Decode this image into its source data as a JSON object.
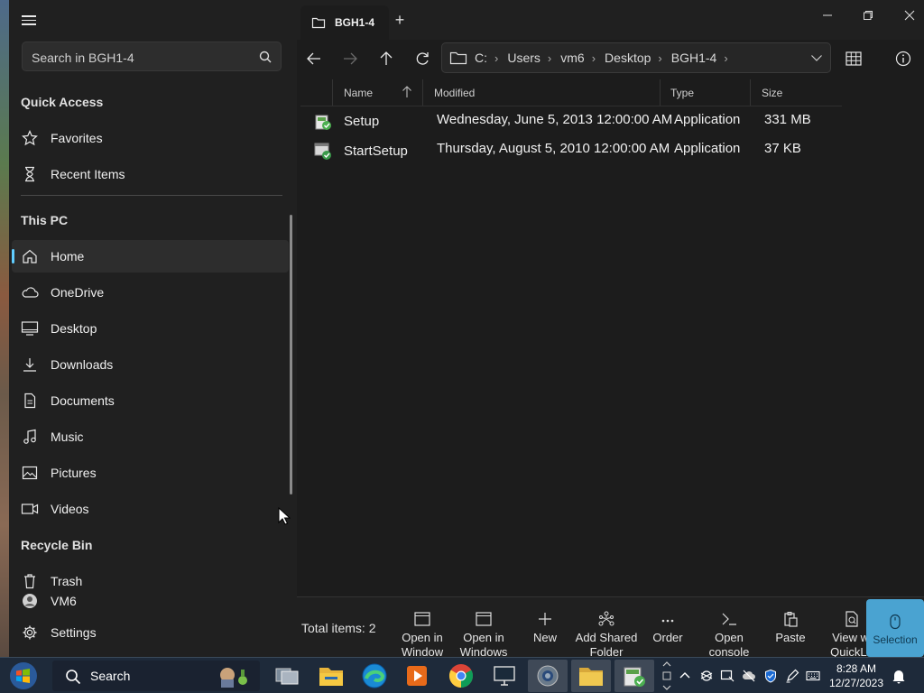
{
  "sidebar": {
    "search_placeholder": "Search in BGH1-4",
    "quick_access_heading": "Quick Access",
    "quick_access": [
      {
        "label": "Favorites",
        "icon": "star-icon"
      },
      {
        "label": "Recent Items",
        "icon": "hourglass-icon"
      }
    ],
    "this_pc_heading": "This PC",
    "this_pc": [
      {
        "label": "Home",
        "icon": "home-icon",
        "active": true
      },
      {
        "label": "OneDrive",
        "icon": "cloud-icon"
      },
      {
        "label": "Desktop",
        "icon": "monitor-icon"
      },
      {
        "label": "Downloads",
        "icon": "download-icon"
      },
      {
        "label": "Documents",
        "icon": "document-icon"
      },
      {
        "label": "Music",
        "icon": "music-icon"
      },
      {
        "label": "Pictures",
        "icon": "picture-icon"
      },
      {
        "label": "Videos",
        "icon": "video-icon"
      }
    ],
    "recycle_heading": "Recycle Bin",
    "trash_label": "Trash",
    "user_label": "VM6",
    "settings_label": "Settings"
  },
  "window": {
    "tab_title": "BGH1-4",
    "accent_color": "#60cdff"
  },
  "address": {
    "crumbs": [
      "C:",
      "Users",
      "vm6",
      "Desktop",
      "BGH1-4"
    ]
  },
  "columns": {
    "name": "Name",
    "modified": "Modified",
    "type": "Type",
    "size": "Size"
  },
  "files": [
    {
      "name": "Setup",
      "modified": "Wednesday, June 5, 2013 12:00:00 AM",
      "type": "Application",
      "size": "331 MB"
    },
    {
      "name": "StartSetup",
      "modified": "Thursday, August 5, 2010 12:00:00 AM",
      "type": "Application",
      "size": "37 KB"
    }
  ],
  "status": {
    "total": "Total items: 2"
  },
  "toolbar": {
    "open_window_1": "Open in",
    "open_window_2": "Window",
    "open_windows_1": "Open in",
    "open_windows_2": "Windows",
    "new": "New",
    "add_shared_1": "Add Shared",
    "add_shared_2": "Folder",
    "order": "Order",
    "open_console_1": "Open",
    "open_console_2": "console",
    "paste": "Paste",
    "quicklook_1": "View wi",
    "quicklook_2": "QuickLo",
    "selection": "Selection"
  },
  "taskbar": {
    "search_label": "Search",
    "time": "8:28 AM",
    "date": "12/27/2023"
  }
}
